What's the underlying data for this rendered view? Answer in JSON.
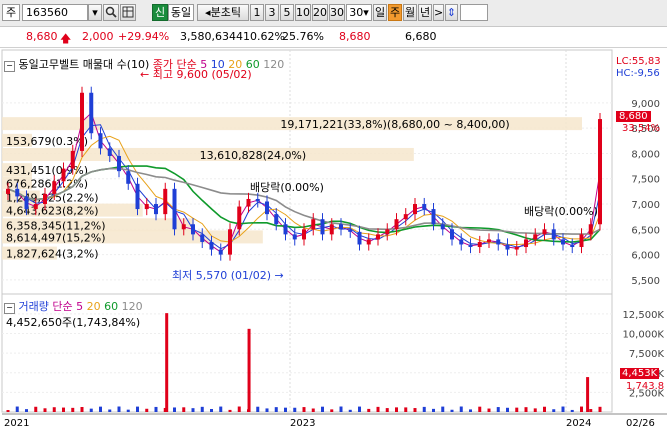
{
  "toolbar": {
    "market": "주",
    "code": "163560",
    "new_label": "신",
    "same_label": "동일",
    "period_label": "분초틱",
    "periods": [
      "1",
      "3",
      "5",
      "10",
      "20",
      "30"
    ],
    "period_select": "30",
    "day": "일",
    "week": "주",
    "month": "월",
    "year": "년",
    "next": ">"
  },
  "quote": {
    "price": "8,680",
    "change": "2,000",
    "rate": "+29.94%",
    "volume": "3,580,634",
    "vol_ratio": "410.62%",
    "turnover": "25.76%",
    "price2": "8,680",
    "price3": "6,680",
    "colors": {
      "up": "#e0001a",
      "text": "#000000"
    }
  },
  "price_pane": {
    "title": "동일고무벨트 매물대 수(10)",
    "ma_label": "종가 단순",
    "ma_periods": [
      "5",
      "10",
      "20",
      "60",
      "120"
    ],
    "ma_colors": [
      "#c0008c",
      "#1f3fd6",
      "#e8a21a",
      "#0f9a2b",
      "#8c8c8c"
    ],
    "high_label": "최고 9,600 (05/02)",
    "low_label": "최저 5,570 (01/02)",
    "dividend1": "배당락(0.00%)",
    "dividend2": "배당락(0.00%)",
    "lc": "LC:55,83",
    "hc": "HC:-9,56",
    "last_price": "8,680",
    "last_rate": "33.54%",
    "y_ticks": [
      "9,000",
      "8,500",
      "8,000",
      "7,500",
      "7,000",
      "6,500",
      "6,000",
      "5,500"
    ],
    "volume_profile": [
      {
        "label": "19,171,221(33,8%)(8,680,00 ~ 8,400,00)",
        "price": 8560,
        "pct": 33.8
      },
      {
        "label": "153,679(0.3%)",
        "price": 8230,
        "pct": 0.3
      },
      {
        "label": "13,610,828(24,0%)",
        "price": 7950,
        "pct": 24.0
      },
      {
        "label": "431,451(0.9%)",
        "price": 7650,
        "pct": 0.9
      },
      {
        "label": "676,286(1.2%)",
        "price": 7390,
        "pct": 1.2
      },
      {
        "label": "1,249,225(2.2%)",
        "price": 7110,
        "pct": 2.2
      },
      {
        "label": "4,643,623(8,2%)",
        "price": 6850,
        "pct": 8.2
      },
      {
        "label": "6,358,345(11,2%)",
        "price": 6560,
        "pct": 11.2
      },
      {
        "label": "8,614,497(15,2%)",
        "price": 6320,
        "pct": 15.2
      },
      {
        "label": "1,827,624(3,2%)",
        "price": 6000,
        "pct": 3.2
      }
    ]
  },
  "volume_pane": {
    "title": "거래량",
    "ma_label": "단순",
    "ma_periods": [
      "5",
      "20",
      "60",
      "120"
    ],
    "ma_colors": [
      "#c0008c",
      "#e8a21a",
      "#0f9a2b",
      "#8c8c8c"
    ],
    "info": "4,452,650주(1,743,84%)",
    "last_volume": "4,453K",
    "last_rate": "1,743.8",
    "y_ticks": [
      "12,500K",
      "10,000K",
      "7,500K",
      "5,000K",
      "2,500K"
    ]
  },
  "x_axis": {
    "labels": [
      "2021",
      "2023",
      "2024",
      "02/26"
    ]
  },
  "chart_data": {
    "type": "candlestick",
    "price_range": [
      5300,
      9650
    ],
    "volume_range": [
      0,
      13000000
    ],
    "close_path": [
      7300,
      7150,
      6900,
      7000,
      7200,
      7450,
      7700,
      8050,
      9200,
      8400,
      8100,
      7950,
      7650,
      7400,
      6900,
      7000,
      6800,
      7300,
      6500,
      6600,
      6400,
      6250,
      6100,
      6000,
      6500,
      6950,
      7100,
      7050,
      6800,
      6600,
      6400,
      6300,
      6500,
      6700,
      6400,
      6600,
      6500,
      6450,
      6200,
      6300,
      6400,
      6500,
      6700,
      6800,
      7000,
      6900,
      6600,
      6500,
      6300,
      6200,
      6150,
      6250,
      6300,
      6200,
      6100,
      6150,
      6300,
      6400,
      6500,
      6300,
      6200,
      6150,
      6400,
      6600,
      8680
    ],
    "volume_spikes": [
      {
        "x": 0.27,
        "v": 12600000
      },
      {
        "x": 0.405,
        "v": 10600000
      },
      {
        "x": 0.96,
        "v": 4450000
      }
    ]
  }
}
